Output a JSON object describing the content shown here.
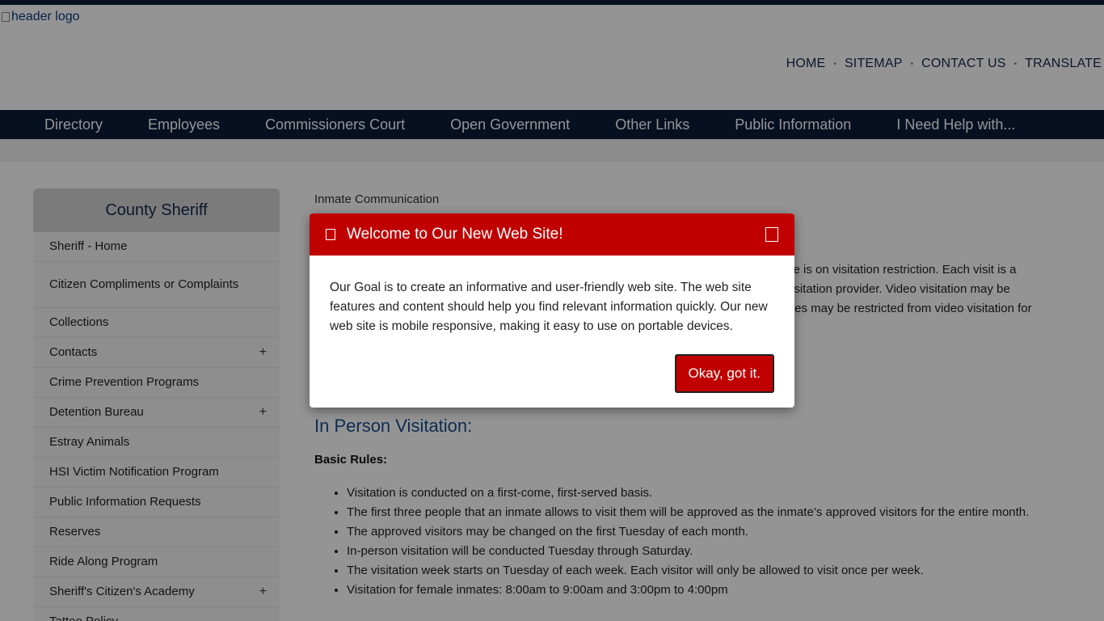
{
  "header": {
    "logo_alt": "header logo",
    "utility_links": [
      "HOME",
      "SITEMAP",
      "CONTACT US",
      "TRANSLATE"
    ]
  },
  "nav": {
    "items": [
      "Directory",
      "Employees",
      "Commissioners Court",
      "Open Government",
      "Other Links",
      "Public Information",
      "I Need Help with..."
    ]
  },
  "sidebar": {
    "title": "County Sheriff",
    "items": [
      {
        "label": "Sheriff - Home",
        "expandable": false
      },
      {
        "label": "Citizen Compliments or Complaints",
        "expandable": false
      },
      {
        "label": "Collections",
        "expandable": false
      },
      {
        "label": "Contacts",
        "expandable": true
      },
      {
        "label": "Crime Prevention Programs",
        "expandable": false
      },
      {
        "label": "Detention Bureau",
        "expandable": true
      },
      {
        "label": "Estray Animals",
        "expandable": false
      },
      {
        "label": "HSI Victim Notification Program",
        "expandable": false
      },
      {
        "label": "Public Information Requests",
        "expandable": false
      },
      {
        "label": "Reserves",
        "expandable": false
      },
      {
        "label": "Ride Along Program",
        "expandable": false
      },
      {
        "label": "Sheriff's Citizen's Academy",
        "expandable": true
      },
      {
        "label": "Tattoo Policy",
        "expandable": false
      }
    ],
    "expand_glyph": "+"
  },
  "content": {
    "breadcrumb": "Inmate Communication",
    "bg_lines": [
      "ate is on visitation restriction.  Each visit is a",
      "isitation provider.  Video visitation may be",
      "tes may be restricted from video visitation for"
    ],
    "section_title": "In Person Visitation:",
    "basic_rules_label": "Basic Rules:",
    "rules": [
      "Visitation is conducted on a first-come, first-served basis.",
      "The first three people that an inmate allows to visit them will be approved as the inmate’s approved visitors for the entire month.",
      "The approved visitors may be changed on the first Tuesday of each month.",
      "In-person visitation will be conducted Tuesday through Saturday.",
      "The visitation week starts on Tuesday of each week.  Each visitor will only be allowed to visit once per week.",
      "Visitation for female inmates: 8:00am to 9:00am and 3:00pm to 4:00pm"
    ]
  },
  "modal": {
    "title": "Welcome to Our New Web Site!",
    "body": "Our Goal is to create an informative and user-friendly web site.  The web site features and content should help you find relevant information quickly.  Our new web site is mobile responsive, making it easy to use on portable devices.",
    "button_label": "Okay, got it."
  },
  "colors": {
    "navy": "#0b1d3a",
    "modal_red": "#c00000",
    "link_blue": "#1a4d8c"
  }
}
